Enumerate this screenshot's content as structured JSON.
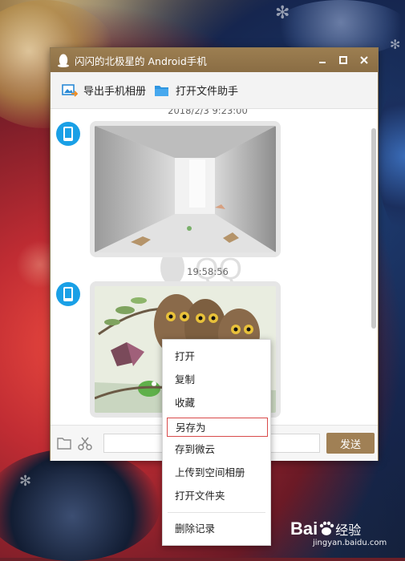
{
  "window": {
    "title": "闪闪的北极星的 Android手机",
    "controls": [
      "minimize-icon",
      "maximize-icon",
      "close-icon"
    ]
  },
  "toolbar": {
    "export_album": "导出手机相册",
    "open_file_helper": "打开文件助手"
  },
  "chat": {
    "timestamp_1": "2018/2/3 9:23:00",
    "timestamp_2": "19:58:56"
  },
  "bottom": {
    "send_label": "发送",
    "input_value": ""
  },
  "context_menu": {
    "items": [
      "打开",
      "复制",
      "收藏",
      "另存为",
      "存到微云",
      "上传到空间相册",
      "打开文件夹",
      "删除记录"
    ],
    "selected": "另存为"
  },
  "watermark": {
    "brand": "Bai",
    "brand_suffix": "经验",
    "url": "jingyan.baidu.com"
  },
  "colors": {
    "titlebar": "#9c7e51",
    "send_button": "#a08055",
    "avatar": "#1aa0e6",
    "menu_highlight_border": "#d94a4a"
  }
}
